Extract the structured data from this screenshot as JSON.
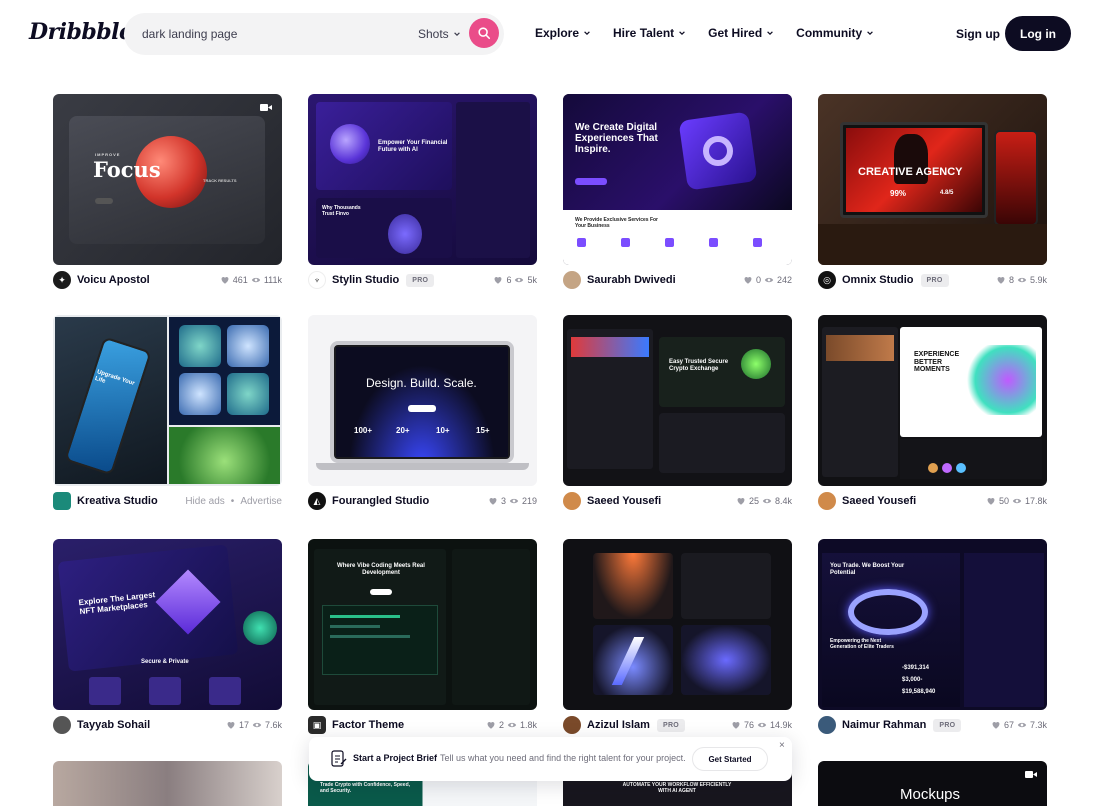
{
  "header": {
    "logo": "Dribbble",
    "search_value": "dark landing page",
    "search_type": "Shots",
    "nav": [
      "Explore",
      "Hire Talent",
      "Get Hired",
      "Community"
    ],
    "signup": "Sign up",
    "login": "Log in"
  },
  "shots": [
    {
      "author": "Voicu Apostol",
      "pro": "",
      "likes": "461",
      "views": "111k",
      "avatar_color": "#1b1b1b",
      "bg": "#2f3138"
    },
    {
      "author": "Stylin Studio",
      "pro": "PRO",
      "likes": "6",
      "views": "5k",
      "avatar_color": "#ffffff",
      "bg": "#1b0f3d"
    },
    {
      "author": "Saurabh Dwivedi",
      "pro": "",
      "likes": "0",
      "views": "242",
      "avatar_color": "#c4a484",
      "bg": "#0b0820"
    },
    {
      "author": "Omnix Studio",
      "pro": "PRO",
      "likes": "8",
      "views": "5.9k",
      "avatar_color": "#111111",
      "bg": "#2a1c16"
    },
    {
      "author": "Kreativa Studio",
      "ad": [
        "Hide ads",
        "•",
        "Advertise"
      ],
      "avatar_color": "#1b8a7a",
      "bg": "#1e3040"
    },
    {
      "author": "Fourangled Studio",
      "pro": "",
      "likes": "3",
      "views": "219",
      "avatar_color": "#111111",
      "bg": "#f2f2f4"
    },
    {
      "author": "Saeed Yousefi",
      "pro": "",
      "likes": "25",
      "views": "8.4k",
      "avatar_color": "#d08a4a",
      "bg": "#141418"
    },
    {
      "author": "Saeed Yousefi",
      "pro": "",
      "likes": "50",
      "views": "17.8k",
      "avatar_color": "#d08a4a",
      "bg": "#111114"
    },
    {
      "author": "Tayyab Sohail",
      "pro": "",
      "likes": "17",
      "views": "7.6k",
      "avatar_color": "#555555",
      "bg": "#1a1440"
    },
    {
      "author": "Factor Theme",
      "pro": "",
      "likes": "2",
      "views": "1.8k",
      "avatar_color": "#2a2a2a",
      "bg": "#0e1714"
    },
    {
      "author": "Azizul Islam",
      "pro": "PRO",
      "likes": "76",
      "views": "14.9k",
      "avatar_color": "#7a4a2a",
      "bg": "#111116"
    },
    {
      "author": "Naimur Rahman",
      "pro": "PRO",
      "likes": "67",
      "views": "7.3k",
      "avatar_color": "#3a5a7a",
      "bg": "#0d0a26"
    }
  ],
  "thumb_text": {
    "s0_small": "IMPROVE",
    "s0_big": "Focus",
    "s0_side": "TRACK RESULTS",
    "s1_head": "Empower Your Financial Future with AI",
    "s1_sub": "Why Thousands Trust Finvo",
    "s2_head": "We Create Digital Experiences That Inspire.",
    "s2_sub": "We Provide Exclusive Services For Your Business",
    "s3_head": "CREATIVE AGENCY",
    "s3_stat": "99%",
    "s3_rating": "4.8/5",
    "s4_head": "Upgrade Your Life",
    "s5_head": "Design. Build. Scale.",
    "s5_stats": [
      "100+",
      "20+",
      "10+",
      "15+"
    ],
    "s6_head": "Easy Trusted Secure Crypto Exchange",
    "s7_head": "EXPERIENCE BETTER MOMENTS",
    "s8_head": "Explore The Largest NFT Marketplaces",
    "s8_sub": "Secure & Private",
    "s9_head": "Where Vibe Coding Meets Real Development",
    "s11_head": "You Trade. We Boost Your Potential",
    "s11_sub": "Empowering the Next Generation of Elite Traders",
    "s11_stats": [
      "-$391,314",
      "$3,000-",
      "$19,588,940"
    ],
    "row4_c2": "Trade Crypto with Confidence, Speed, and Security.",
    "row4_c3": "AUTOMATE YOUR WORKFLOW EFFICIENTLY WITH AI AGENT",
    "row4_c4": "Mockups"
  },
  "banner": {
    "title": "Start a Project Brief",
    "text": "Tell us what you need and find the right talent for your project.",
    "button": "Get Started",
    "close": "×"
  },
  "colors": {
    "accent": "#ea4c89",
    "ink": "#0d0c22",
    "muted": "#6e6d7a"
  },
  "icons": [
    "search-icon",
    "chevron-down-icon",
    "heart-icon",
    "eye-icon",
    "video-icon",
    "brief-icon",
    "close-icon"
  ]
}
